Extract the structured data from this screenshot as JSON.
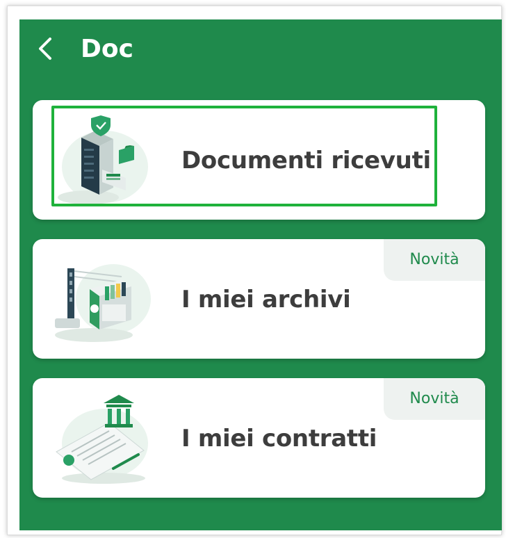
{
  "header": {
    "title": "Doc",
    "back_icon": "chevron-left-icon"
  },
  "cards": [
    {
      "label": "Documenti ricevuti",
      "icon": "file-cabinet-illustration",
      "badge": ""
    },
    {
      "label": "I miei archivi",
      "icon": "archive-illustration",
      "badge": "Novità"
    },
    {
      "label": "I miei contratti",
      "icon": "contract-illustration",
      "badge": "Novità"
    }
  ],
  "colors": {
    "background": "#1f8a4c",
    "card": "#ffffff",
    "label_text": "#3d3d3d",
    "badge_bg": "#eef2f0",
    "badge_text": "#1f8a4c",
    "highlight": "#1fb23b"
  }
}
